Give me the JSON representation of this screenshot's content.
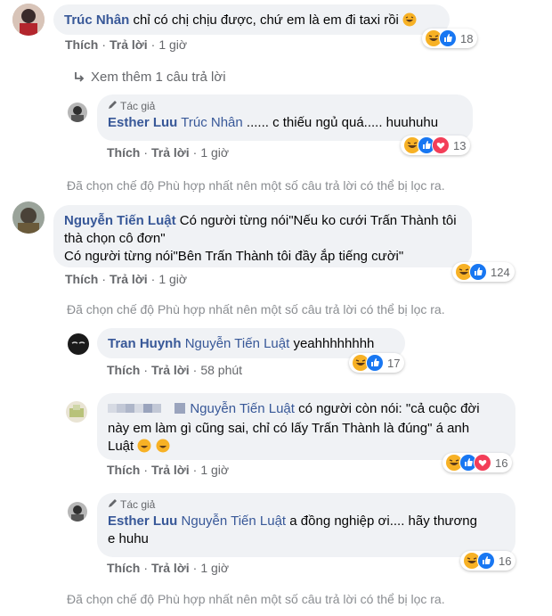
{
  "comments": [
    {
      "name": "Trúc Nhân",
      "text": "chỉ có chị chịu được, chứ em là em đi taxi rồi",
      "actions": {
        "like": "Thích",
        "reply": "Trả lời",
        "time": "1 giờ"
      },
      "reaction_count": "18"
    },
    {
      "more": "Xem thêm 1 câu trả lời"
    },
    {
      "badge": "Tác giả",
      "name": "Esther Luu",
      "tag": "Trúc Nhân",
      "text": "...... c thiếu ngủ quá..... huuhuhu",
      "actions": {
        "like": "Thích",
        "reply": "Trả lời",
        "time": "1 giờ"
      },
      "reaction_count": "13"
    },
    {
      "note": "Đã chọn chế độ Phù hợp nhất nên một số câu trả lời có thể bị lọc ra."
    },
    {
      "name": "Nguyễn Tiến Luật",
      "text_lines": [
        "Có người từng nói\"Nếu ko cưới Trấn Thành tôi",
        "thà chọn cô đơn\"",
        "Có người từng nói\"Bên Trấn Thành tôi đầy ắp tiếng cười\""
      ],
      "actions": {
        "like": "Thích",
        "reply": "Trả lời",
        "time": "1 giờ"
      },
      "reaction_count": "124"
    },
    {
      "note": "Đã chọn chế độ Phù hợp nhất nên một số câu trả lời có thể bị lọc ra."
    },
    {
      "name": "Tran Huynh",
      "tag": "Nguyễn Tiến Luật",
      "text": "yeahhhhhhhh",
      "actions": {
        "like": "Thích",
        "reply": "Trả lời",
        "time": "58 phút"
      },
      "reaction_count": "17"
    },
    {
      "tag": "Nguyễn Tiến Luật",
      "text_lines": [
        "có người còn nói: \"cả cuộc đời",
        "này em làm gì cũng sai, chỉ có lấy Trấn Thành là đúng\" á anh",
        "Luật"
      ],
      "actions": {
        "like": "Thích",
        "reply": "Trả lời",
        "time": "1 giờ"
      },
      "reaction_count": "16"
    },
    {
      "badge": "Tác giả",
      "name": "Esther Luu",
      "tag": "Nguyễn Tiến Luật",
      "text_lines": [
        "a đồng nghiệp ơi.... hãy thương",
        "e huhu"
      ],
      "actions": {
        "like": "Thích",
        "reply": "Trả lời",
        "time": "1 giờ"
      },
      "reaction_count": "16"
    },
    {
      "note": "Đã chọn chế độ Phù hợp nhất nên một số câu trả lời có thể bị lọc ra."
    }
  ],
  "colors": {
    "name": "#385898",
    "bubble": "#f0f2f5",
    "muted": "#65676b",
    "haha": "#f7b125",
    "like": "#1877f2",
    "love": "#f33e58"
  },
  "icons": [
    "haha-emoji-icon",
    "like-reaction-icon",
    "love-reaction-icon",
    "wow-reaction-icon",
    "reply-arrow-icon",
    "pencil-icon",
    "verified-badge-icon"
  ]
}
